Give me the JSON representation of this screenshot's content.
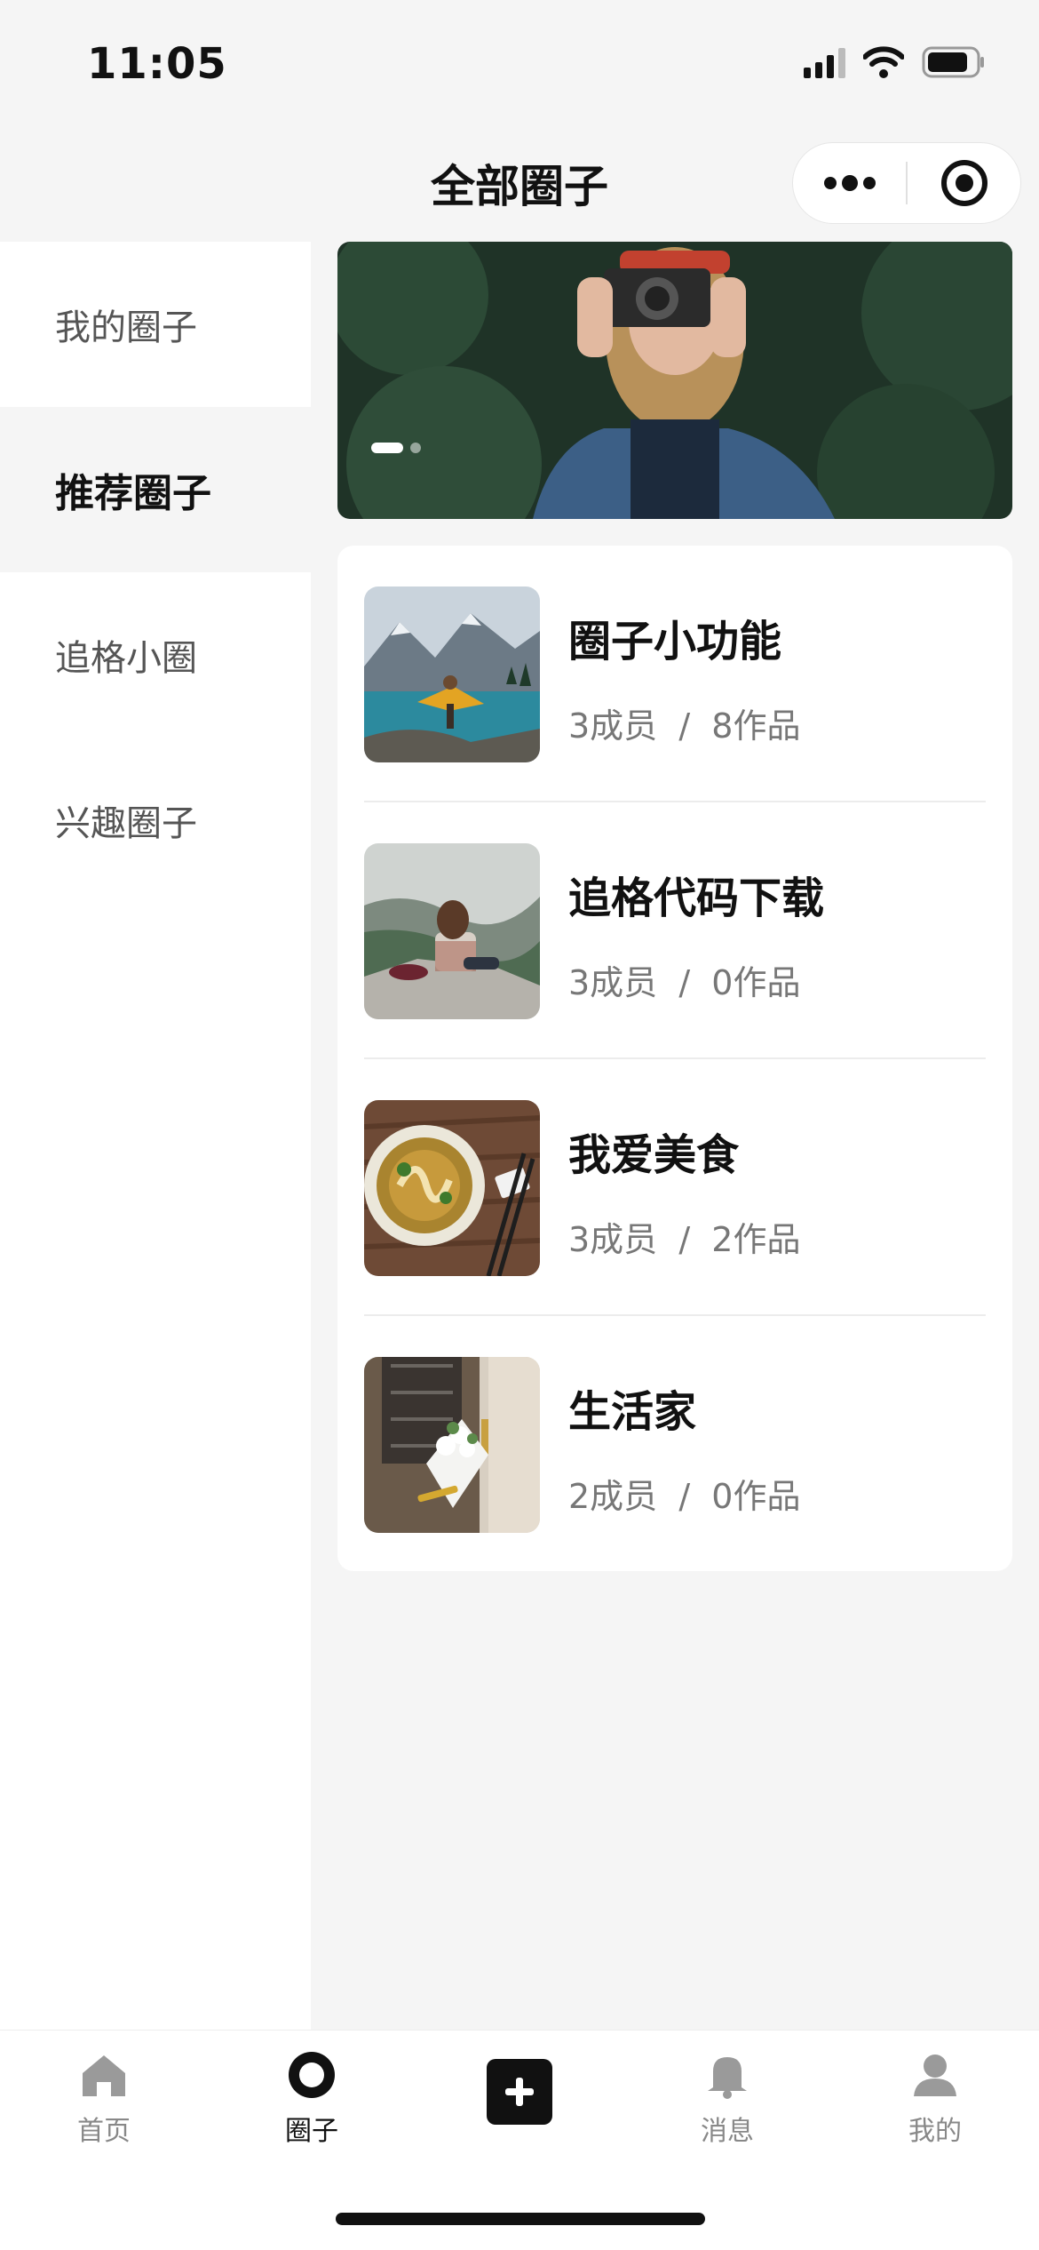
{
  "status_bar": {
    "time": "11:05"
  },
  "header": {
    "title": "全部圈子"
  },
  "sidebar": {
    "items": [
      {
        "label": "我的圈子",
        "active": false
      },
      {
        "label": "推荐圈子",
        "active": true
      },
      {
        "label": "追格小圈",
        "active": false
      },
      {
        "label": "兴趣圈子",
        "active": false
      }
    ]
  },
  "circles": [
    {
      "name": "圈子小功能",
      "meta": "3成员  /  8作品",
      "thumb": "lake-photo-icon"
    },
    {
      "name": "追格代码下载",
      "meta": "3成员  /  0作品",
      "thumb": "cliff-photo-icon"
    },
    {
      "name": "我爱美食",
      "meta": "3成员  /  2作品",
      "thumb": "noodle-bowl-photo-icon"
    },
    {
      "name": "生活家",
      "meta": "2成员  /  0作品",
      "thumb": "flowers-door-photo-icon"
    }
  ],
  "tab_bar": {
    "tabs": [
      {
        "label": "首页",
        "icon": "home-icon",
        "active": false
      },
      {
        "label": "圈子",
        "icon": "circle-icon",
        "active": true
      },
      {
        "label": "",
        "icon": "add-icon",
        "active": false
      },
      {
        "label": "消息",
        "icon": "bell-icon",
        "active": false
      },
      {
        "label": "我的",
        "icon": "user-icon",
        "active": false
      }
    ]
  },
  "colors": {
    "background": "#f5f5f5",
    "surface": "#ffffff",
    "text": "#111111",
    "muted": "#777777"
  }
}
